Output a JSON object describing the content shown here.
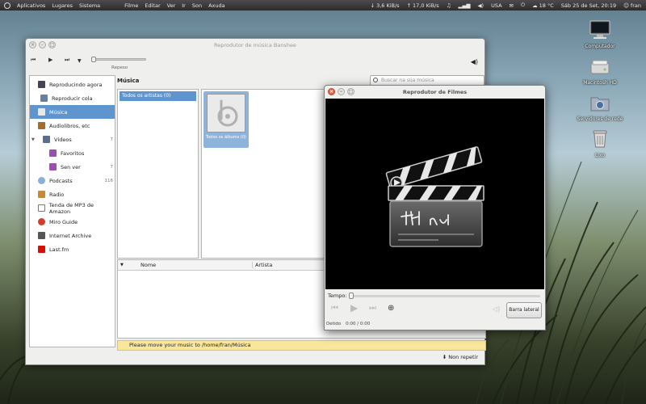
{
  "top_panel": {
    "menus": [
      "Aplicativos",
      "Lugares",
      "Sistema"
    ],
    "app_menus": [
      "Filme",
      "Editar",
      "Ver",
      "Ir",
      "Son",
      "Axuda"
    ],
    "net_down": "3,6 KiB/s",
    "net_up": "17,0 KiB/s",
    "keyboard": "USA",
    "weather": "18 °C",
    "clock": "Sáb 25 de Set, 20:19",
    "user": "fran"
  },
  "desktop": {
    "icons": [
      {
        "label": "Computador",
        "icon": "computer-icon"
      },
      {
        "label": "Macintosh HD",
        "icon": "harddisk-icon"
      },
      {
        "label": "Servidores de rede",
        "icon": "network-folder-icon"
      },
      {
        "label": "Lixo",
        "icon": "trash-icon"
      }
    ]
  },
  "banshee": {
    "title": "Reprodutor de música Banshee",
    "status_label": "Repeso",
    "sidebar": [
      {
        "label": "Reproducindo agora",
        "count": ""
      },
      {
        "label": "Reproducir cola",
        "count": ""
      },
      {
        "label": "Música",
        "count": ""
      },
      {
        "label": "Audiolibros, etc",
        "count": ""
      },
      {
        "label": "Vídeos",
        "count": "7"
      },
      {
        "label": "Favoritos",
        "count": ""
      },
      {
        "label": "Sen ver",
        "count": "7"
      },
      {
        "label": "Podcasts",
        "count": "116"
      },
      {
        "label": "Radio",
        "count": ""
      },
      {
        "label": "Tenda de MP3 de Amazon",
        "count": ""
      },
      {
        "label": "Miro Guide",
        "count": ""
      },
      {
        "label": "Internet Archive",
        "count": ""
      },
      {
        "label": "Last.fm",
        "count": ""
      }
    ],
    "content_title": "Música",
    "search_placeholder": "Buscar na súa música",
    "artist_item": "Todos os artistas (0)",
    "album_item": "Todos os álbums (0)",
    "columns": [
      "Nome",
      "Artista"
    ],
    "infobar": "Please move your music to /home/fran/Música",
    "repeat": "Non repetir"
  },
  "totem": {
    "title": "Reprodutor de Filmes",
    "tempo_label": "Tempo:",
    "sidebar_button": "Barra lateral",
    "state": "Detido",
    "time": "0:00 / 0:00"
  },
  "colors": {
    "selection": "#5f95cf",
    "infobar": "#fae69a",
    "close_button": "#e2674a"
  }
}
